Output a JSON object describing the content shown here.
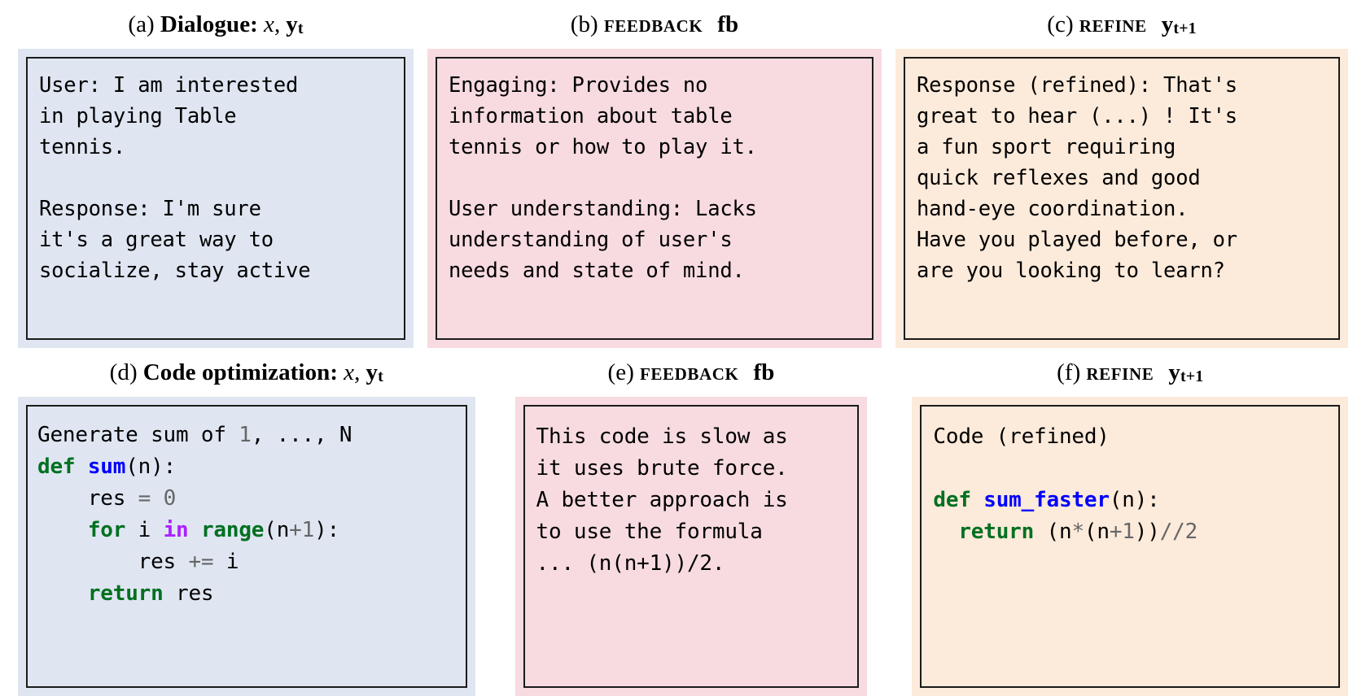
{
  "figure": {
    "background_color": "#ffffff",
    "panel_colors": {
      "dialogue_blue": "#dfe6f2",
      "feedback_pink": "#f7dbe0",
      "refine_orange": "#fceada",
      "border": "#1b1b1b"
    },
    "syntax_colors": {
      "keyword": "#007020",
      "function_name": "#0000ff",
      "operator_word": "#aa22ff",
      "number": "#666666",
      "operator": "#666666",
      "plain": "#000000"
    }
  },
  "captions": {
    "a": {
      "marker": "(a)",
      "title": "Dialogue:",
      "var1": "x",
      "sep": ",",
      "var2": "y",
      "var2_sub": "t"
    },
    "b": {
      "marker": "(b)",
      "title": "Feedback",
      "var1": "fb"
    },
    "c": {
      "marker": "(c)",
      "title": "Refine",
      "var1": "y",
      "var1_sub": "t+1"
    },
    "d": {
      "marker": "(d)",
      "title": "Code optimization:",
      "var1": "x",
      "sep": ",",
      "var2": "y",
      "var2_sub": "t"
    },
    "e": {
      "marker": "(e)",
      "title": "Feedback",
      "var1": "fb"
    },
    "f": {
      "marker": "(f)",
      "title": "Refine",
      "var1": "y",
      "var1_sub": "t+1"
    }
  },
  "panels": {
    "a": {
      "id": "dialogue-input",
      "background": "#dfe6f2",
      "text": "User: I am interested\nin playing Table\ntennis.\n\nResponse: I'm sure\nit's a great way to\nsocialize, stay active"
    },
    "b": {
      "id": "dialogue-feedback",
      "background": "#f7dbe0",
      "text": "Engaging: Provides no\ninformation about table\ntennis or how to play it.\n\nUser understanding: Lacks\nunderstanding of user's\nneeds and state of mind."
    },
    "c": {
      "id": "dialogue-refine",
      "background": "#fceada",
      "text": "Response (refined): That's\ngreat to hear (...) ! It's\na fun sport requiring\nquick reflexes and good\nhand-eye coordination.\nHave you played before, or\nare you looking to learn?"
    },
    "e": {
      "id": "code-feedback",
      "background": "#f7dbe0",
      "text": "This code is slow as\nit uses brute force.\nA better approach is\nto use the formula\n... (n(n+1))/2."
    }
  },
  "code_panels": {
    "d": {
      "id": "code-optimization-input",
      "background": "#dfe6f2",
      "lines": [
        [
          {
            "t": "Generate sum of ",
            "c": "plain"
          },
          {
            "t": "1",
            "c": "num"
          },
          {
            "t": ", ..., N",
            "c": "plain"
          }
        ],
        [
          {
            "t": "def",
            "c": "kw"
          },
          {
            "t": " ",
            "c": "plain"
          },
          {
            "t": "sum",
            "c": "fn"
          },
          {
            "t": "(n):",
            "c": "plain"
          }
        ],
        [
          {
            "t": "    res ",
            "c": "plain"
          },
          {
            "t": "=",
            "c": "op"
          },
          {
            "t": " ",
            "c": "plain"
          },
          {
            "t": "0",
            "c": "num"
          }
        ],
        [
          {
            "t": "    ",
            "c": "plain"
          },
          {
            "t": "for",
            "c": "kw"
          },
          {
            "t": " i ",
            "c": "plain"
          },
          {
            "t": "in",
            "c": "opw"
          },
          {
            "t": " ",
            "c": "plain"
          },
          {
            "t": "range",
            "c": "kw"
          },
          {
            "t": "(n",
            "c": "plain"
          },
          {
            "t": "+",
            "c": "op"
          },
          {
            "t": "1",
            "c": "num"
          },
          {
            "t": "):",
            "c": "plain"
          }
        ],
        [
          {
            "t": "        res ",
            "c": "plain"
          },
          {
            "t": "+=",
            "c": "op"
          },
          {
            "t": " i",
            "c": "plain"
          }
        ],
        [
          {
            "t": "    ",
            "c": "plain"
          },
          {
            "t": "return",
            "c": "kw"
          },
          {
            "t": " res",
            "c": "plain"
          }
        ]
      ]
    },
    "f": {
      "id": "code-optimization-refine",
      "background": "#fceada",
      "lines": [
        [
          {
            "t": "Code (refined)",
            "c": "plain"
          }
        ],
        [
          {
            "t": "",
            "c": "plain"
          }
        ],
        [
          {
            "t": "def",
            "c": "kw"
          },
          {
            "t": " ",
            "c": "plain"
          },
          {
            "t": "sum_faster",
            "c": "fn"
          },
          {
            "t": "(n):",
            "c": "plain"
          }
        ],
        [
          {
            "t": "  ",
            "c": "plain"
          },
          {
            "t": "return",
            "c": "kw"
          },
          {
            "t": " (n",
            "c": "plain"
          },
          {
            "t": "*",
            "c": "op"
          },
          {
            "t": "(n",
            "c": "plain"
          },
          {
            "t": "+",
            "c": "op"
          },
          {
            "t": "1",
            "c": "num"
          },
          {
            "t": "))",
            "c": "plain"
          },
          {
            "t": "//",
            "c": "op"
          },
          {
            "t": "2",
            "c": "num"
          }
        ]
      ]
    }
  }
}
